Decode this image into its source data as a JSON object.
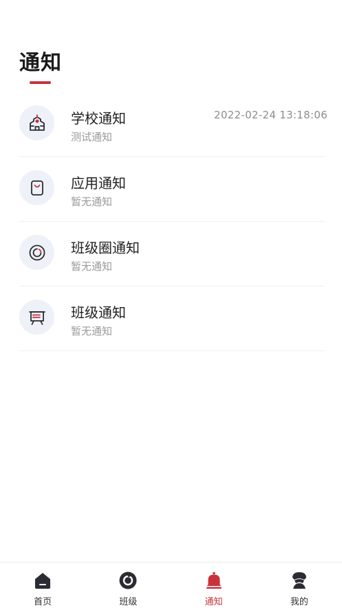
{
  "page": {
    "title": "通知"
  },
  "notifications": [
    {
      "title": "学校通知",
      "subtitle": "测试通知",
      "time": "2022-02-24 13:18:06",
      "icon": "school-icon"
    },
    {
      "title": "应用通知",
      "subtitle": "暂无通知",
      "time": "",
      "icon": "bag-icon"
    },
    {
      "title": "班级圈通知",
      "subtitle": "暂无通知",
      "time": "",
      "icon": "circle-icon"
    },
    {
      "title": "班级通知",
      "subtitle": "暂无通知",
      "time": "",
      "icon": "board-icon"
    }
  ],
  "tabbar": {
    "items": [
      {
        "label": "首页",
        "icon": "home-icon",
        "active": false
      },
      {
        "label": "班级",
        "icon": "class-icon",
        "active": false
      },
      {
        "label": "通知",
        "icon": "bell-icon",
        "active": true
      },
      {
        "label": "我的",
        "icon": "profile-icon",
        "active": false
      }
    ]
  },
  "colors": {
    "accent": "#c9323c",
    "icon_bg": "#eef1f8",
    "icon_stroke": "#2b2b33"
  }
}
